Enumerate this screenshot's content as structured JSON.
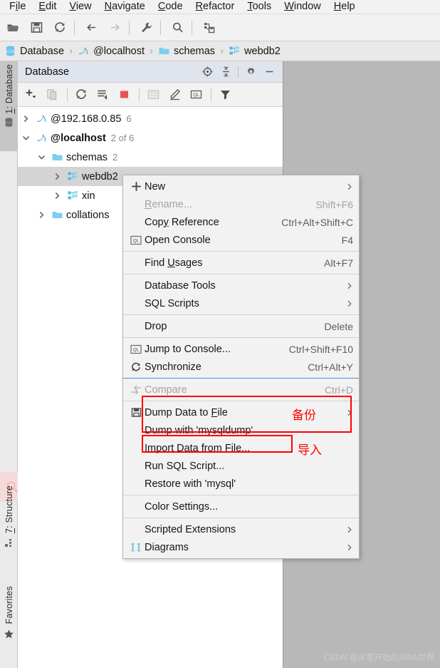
{
  "menubar": {
    "items": [
      {
        "pre": "F",
        "mn": "i",
        "post": "le"
      },
      {
        "pre": "",
        "mn": "E",
        "post": "dit"
      },
      {
        "pre": "",
        "mn": "V",
        "post": "iew"
      },
      {
        "pre": "",
        "mn": "N",
        "post": "avigate"
      },
      {
        "pre": "",
        "mn": "C",
        "post": "ode"
      },
      {
        "pre": "",
        "mn": "R",
        "post": "efactor"
      },
      {
        "pre": "",
        "mn": "T",
        "post": "ools"
      },
      {
        "pre": "",
        "mn": "W",
        "post": "indow"
      },
      {
        "pre": "",
        "mn": "H",
        "post": "elp"
      }
    ]
  },
  "toolbar": {
    "buttons": [
      {
        "name": "open-folder-icon",
        "enabled": true
      },
      {
        "name": "save-all-icon",
        "enabled": true
      },
      {
        "name": "refresh-icon",
        "enabled": true
      },
      {
        "name": "back-arrow-icon",
        "enabled": true
      },
      {
        "name": "forward-arrow-icon",
        "enabled": false
      },
      {
        "name": "wrench-settings-icon",
        "enabled": true
      },
      {
        "name": "search-icon",
        "enabled": true
      },
      {
        "name": "database-save-icon",
        "enabled": true
      }
    ]
  },
  "breadcrumb": {
    "separator": "›",
    "items": [
      {
        "label": "Database",
        "icon": "database-icon"
      },
      {
        "label": "@localhost",
        "icon": "mysql-dolphin-icon"
      },
      {
        "label": "schemas",
        "icon": "folder-icon"
      },
      {
        "label": "webdb2",
        "icon": "schema-icon"
      }
    ]
  },
  "rail": {
    "database_label_pre": "",
    "database_label_mn": "1",
    "database_label_post": ": Database",
    "structure_label_mn": "7",
    "structure_label_post": ": Structure",
    "favorites_label": "Favorites"
  },
  "database_panel": {
    "title": "Database",
    "header_buttons": [
      {
        "name": "locate-crosshair-icon"
      },
      {
        "name": "collapse-all-icon"
      },
      {
        "name": "settings-gear-icon"
      },
      {
        "name": "minimize-icon"
      }
    ],
    "toolbar_buttons": [
      {
        "name": "add-data-source-icon",
        "enabled": true
      },
      {
        "name": "duplicate-icon",
        "enabled": false
      },
      {
        "name": "refresh-icon",
        "enabled": true
      },
      {
        "name": "sync-schema-icon",
        "enabled": true
      },
      {
        "name": "stop-icon",
        "enabled": true
      },
      {
        "name": "table-editor-icon",
        "enabled": false
      },
      {
        "name": "edit-pencil-icon",
        "enabled": true
      },
      {
        "name": "open-console-icon",
        "enabled": true
      },
      {
        "name": "filter-icon",
        "enabled": true
      }
    ],
    "tree": [
      {
        "label": "@192.168.0.85",
        "count": "6",
        "icon": "mysql-dolphin-icon",
        "arrow": "›",
        "indent": 0,
        "bold": false,
        "selected": false
      },
      {
        "label": "@localhost",
        "count": "2 of 6",
        "icon": "mysql-dolphin-icon",
        "arrow": "⌄",
        "indent": 0,
        "bold": true,
        "selected": false
      },
      {
        "label": "schemas",
        "count": "2",
        "icon": "folder-icon",
        "arrow": "⌄",
        "indent": 1,
        "bold": false,
        "selected": false
      },
      {
        "label": "webdb2",
        "count": "",
        "icon": "schema-icon",
        "arrow": "›",
        "indent": 2,
        "bold": false,
        "selected": true
      },
      {
        "label": "xin",
        "count": "",
        "icon": "schema-icon",
        "arrow": "›",
        "indent": 2,
        "bold": false,
        "selected": false
      },
      {
        "label": "collations",
        "count": "",
        "icon": "folder-icon",
        "arrow": "›",
        "indent": 1,
        "bold": false,
        "selected": false
      }
    ]
  },
  "context_menu": {
    "items": [
      {
        "type": "item",
        "icon": "plus-icon",
        "pre": "New",
        "mn": "",
        "post": "",
        "shortcut": "",
        "submenu": true,
        "disabled": false
      },
      {
        "type": "item",
        "icon": "",
        "pre": "",
        "mn": "R",
        "post": "ename...",
        "shortcut": "Shift+F6",
        "submenu": false,
        "disabled": true
      },
      {
        "type": "item",
        "icon": "",
        "pre": "Cop",
        "mn": "y",
        "post": " Reference",
        "shortcut": "Ctrl+Alt+Shift+C",
        "submenu": false,
        "disabled": false
      },
      {
        "type": "item",
        "icon": "console-ql-icon",
        "pre": "Open Console",
        "mn": "",
        "post": "",
        "shortcut": "F4",
        "submenu": false,
        "disabled": false
      },
      {
        "type": "sep"
      },
      {
        "type": "item",
        "icon": "",
        "pre": "Find ",
        "mn": "U",
        "post": "sages",
        "shortcut": "Alt+F7",
        "submenu": false,
        "disabled": false
      },
      {
        "type": "sep"
      },
      {
        "type": "item",
        "icon": "",
        "pre": "Database Tools",
        "mn": "",
        "post": "",
        "shortcut": "",
        "submenu": true,
        "disabled": false
      },
      {
        "type": "item",
        "icon": "",
        "pre": "SQL Scripts",
        "mn": "",
        "post": "",
        "shortcut": "",
        "submenu": true,
        "disabled": false
      },
      {
        "type": "sep"
      },
      {
        "type": "item",
        "icon": "",
        "pre": "Drop",
        "mn": "",
        "post": "",
        "shortcut": "Delete",
        "submenu": false,
        "disabled": false
      },
      {
        "type": "sep"
      },
      {
        "type": "item",
        "icon": "console-ql-icon",
        "pre": "Jump to Console...",
        "mn": "",
        "post": "",
        "shortcut": "Ctrl+Shift+F10",
        "submenu": false,
        "disabled": false
      },
      {
        "type": "item",
        "icon": "sync-icon",
        "pre": "Synchronize",
        "mn": "",
        "post": "",
        "shortcut": "Ctrl+Alt+Y",
        "submenu": false,
        "disabled": false
      },
      {
        "type": "sep-blue"
      },
      {
        "type": "item",
        "icon": "compare-icon",
        "pre": "Compare",
        "mn": "",
        "post": "",
        "shortcut": "Ctrl+D",
        "submenu": false,
        "disabled": true
      },
      {
        "type": "sep"
      },
      {
        "type": "item",
        "icon": "dump-save-icon",
        "pre": "Dump Data to ",
        "mn": "F",
        "post": "ile",
        "shortcut": "",
        "submenu": true,
        "disabled": false
      },
      {
        "type": "item",
        "icon": "",
        "pre": "Dump with 'mysqldump'",
        "mn": "",
        "post": "",
        "shortcut": "",
        "submenu": false,
        "disabled": false
      },
      {
        "type": "item",
        "icon": "",
        "pre": "Import Data from ",
        "mn": "F",
        "post": "ile...",
        "shortcut": "",
        "submenu": false,
        "disabled": false
      },
      {
        "type": "item",
        "icon": "",
        "pre": "Run SQL Script...",
        "mn": "",
        "post": "",
        "shortcut": "",
        "submenu": false,
        "disabled": false
      },
      {
        "type": "item",
        "icon": "",
        "pre": "Restore with 'mysql'",
        "mn": "",
        "post": "",
        "shortcut": "",
        "submenu": false,
        "disabled": false
      },
      {
        "type": "sep"
      },
      {
        "type": "item",
        "icon": "",
        "pre": "Color Settings...",
        "mn": "",
        "post": "",
        "shortcut": "",
        "submenu": false,
        "disabled": false
      },
      {
        "type": "sep"
      },
      {
        "type": "item",
        "icon": "",
        "pre": "Scripted Extensions",
        "mn": "",
        "post": "",
        "shortcut": "",
        "submenu": true,
        "disabled": false
      },
      {
        "type": "item",
        "icon": "diagrams-icon",
        "pre": "Diagrams",
        "mn": "",
        "post": "",
        "shortcut": "",
        "submenu": true,
        "disabled": false
      }
    ]
  },
  "annotations": {
    "backup_label": "备份",
    "import_label": "导入",
    "accent_color": "#fe0000"
  },
  "watermark": {
    "text": "CSDN @从零开始的JAVA世界"
  }
}
